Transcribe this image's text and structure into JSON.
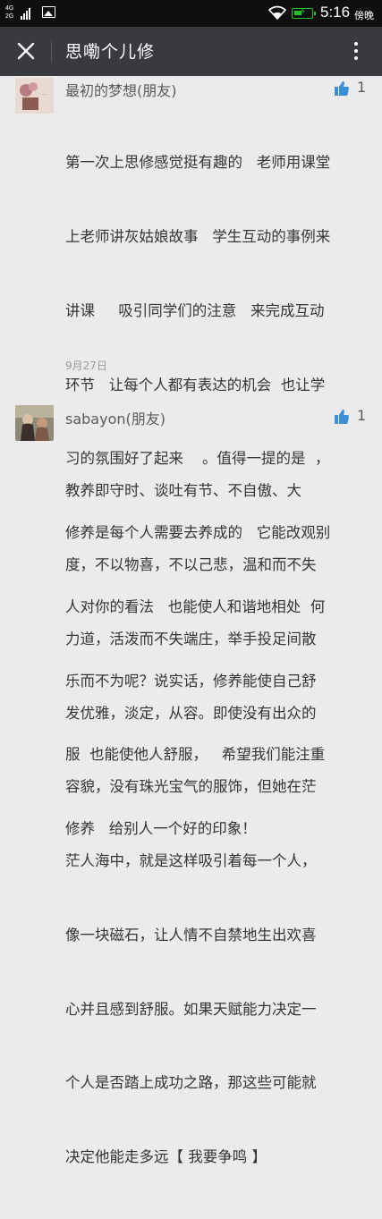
{
  "status_bar": {
    "network_top": "4G",
    "network_bottom": "2G",
    "time": "5:16",
    "period": "傍晚"
  },
  "header": {
    "title": "思嘞个儿修"
  },
  "comments": [
    {
      "name": "最初的梦想(朋友)",
      "likes": "1",
      "lines": [
        "第一次上思修感觉挺有趣的   老师用课堂",
        "上老师讲灰姑娘故事   学生互动的事例来",
        "讲课     吸引同学们的注意   来完成互动",
        "环节   让每个人都有表达的机会  也让学",
        "习的氛围好了起来    。值得一提的是  ，",
        "修养是每个人需要去养成的   它能改观别",
        "人对你的看法   也能使人和谐地相处  何",
        "乐而不为呢？说实话，修养能使自己舒",
        "服  也能使他人舒服，   希望我们能注重",
        "修养   给别人一个好的印象！"
      ],
      "date": "9月27日"
    },
    {
      "name": "sabayon(朋友)",
      "likes": "1",
      "lines": [
        "教养即守时、谈吐有节、不自傲、大",
        "度，不以物喜，不以己悲，温和而不失",
        "力道，活泼而不失端庄，举手投足间散",
        "发优雅，淡定，从容。即使没有出众的",
        "容貌，没有珠光宝气的服饰，但她在茫",
        "茫人海中，就是这样吸引着每一个人，",
        "像一块磁石，让人情不自禁地生出欢喜",
        "心并且感到舒服。如果天赋能力决定一",
        "个人是否踏上成功之路，那这些可能就",
        "决定他能走多远【 我要争鸣 】"
      ]
    }
  ],
  "colors": {
    "status_bar": "#0f0f0f",
    "title_bar": "#393a3f",
    "background": "#ebebeb",
    "like_icon": "#3b8ed8",
    "battery": "#22c22a"
  }
}
